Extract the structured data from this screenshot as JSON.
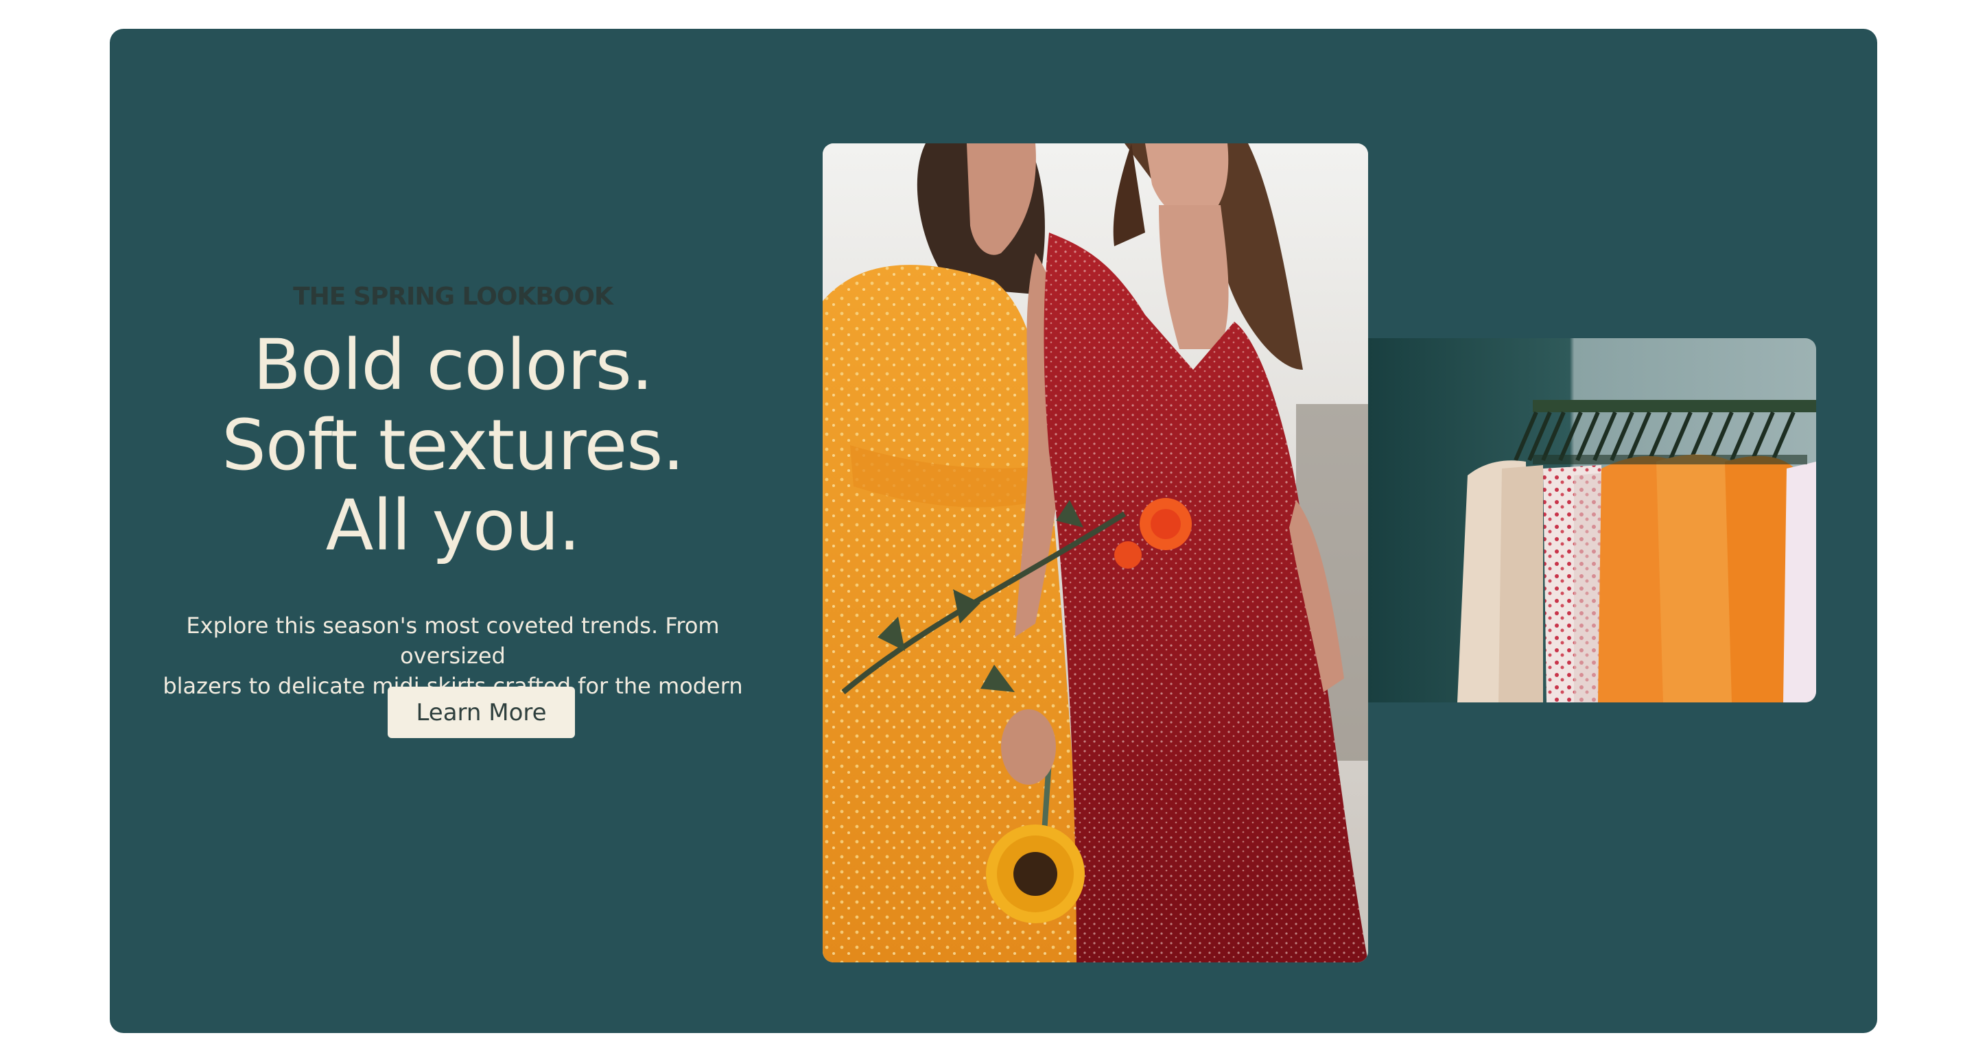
{
  "hero": {
    "eyebrow": "THE SPRING LOOKBOOK",
    "headline": [
      "Bold colors.",
      "Soft textures.",
      "All you."
    ],
    "description": [
      "Explore this season's most coveted trends. From oversized",
      "blazers to delicate midi skirts crafted for the modern woman."
    ],
    "cta_label": "Learn More"
  },
  "images": {
    "main_photo": "two-women-in-dresses-with-flowers-photo",
    "rack_photo": "clothing-rack-photo"
  },
  "colors": {
    "page_background": "#ffffff",
    "hero_background": "#275157",
    "headline_text": "#f3ecdb",
    "eyebrow_text": "#2b3a38",
    "cta_background": "#f4efe2",
    "cta_text": "#2e3f3d"
  }
}
